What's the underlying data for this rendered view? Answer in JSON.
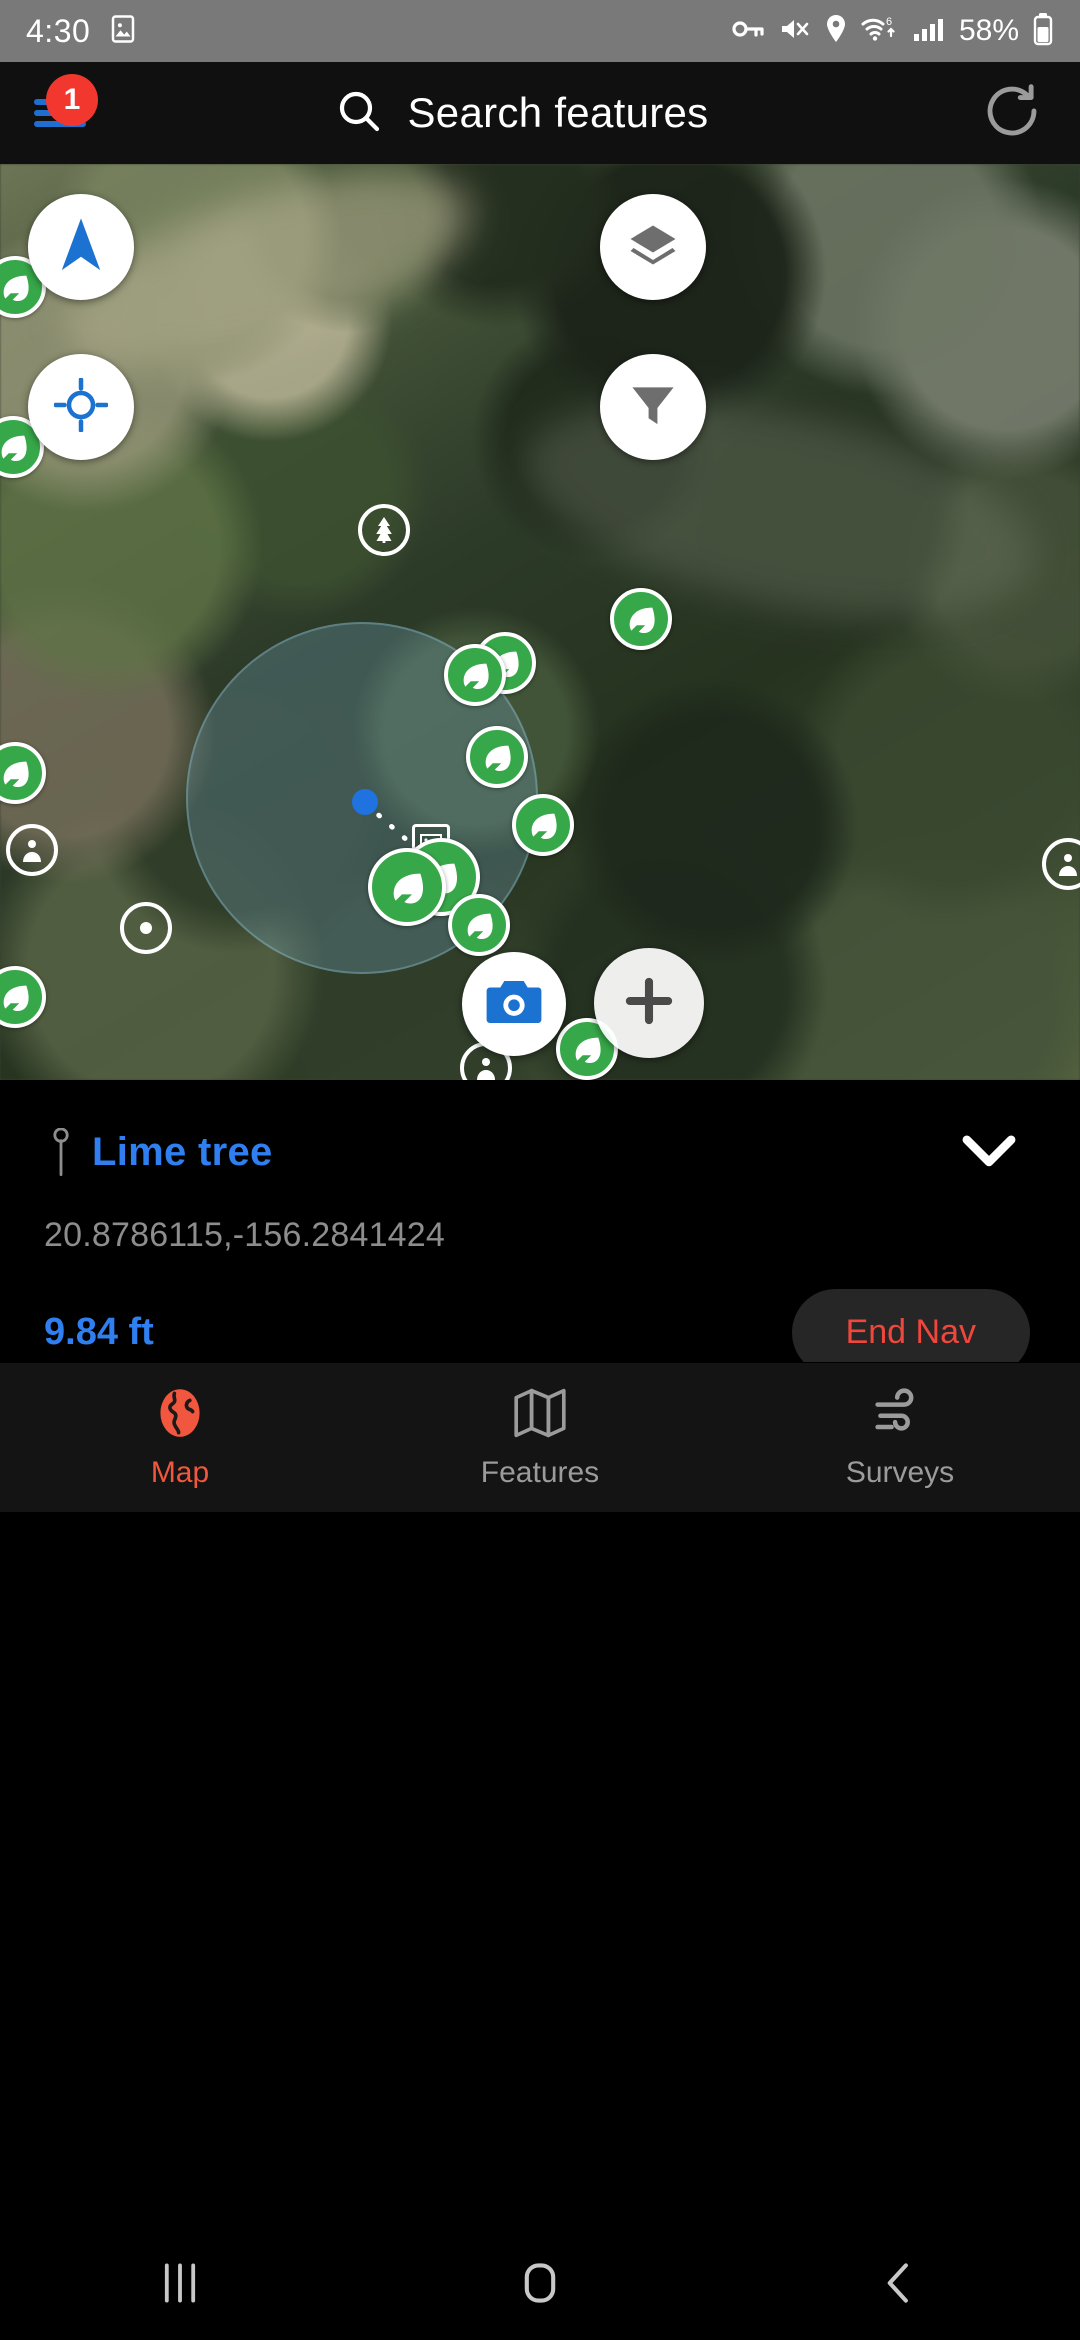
{
  "status_bar": {
    "time": "4:30",
    "battery_percent": "58%",
    "icons": [
      "image-icon",
      "key-icon",
      "mute-icon",
      "location-icon",
      "wifi-6-icon",
      "cell-signal-icon",
      "battery-icon"
    ]
  },
  "app_bar": {
    "menu_icon": "hamburger-menu-icon",
    "menu_badge_count": "1",
    "search_icon": "search-icon",
    "search_placeholder": "Search features",
    "refresh_icon": "refresh-icon"
  },
  "map": {
    "controls": {
      "navigate_icon": "navigation-arrow-icon",
      "locate_icon": "crosshair-target-icon",
      "layers_icon": "layers-icon",
      "filter_icon": "filter-funnel-icon",
      "camera_icon": "camera-icon",
      "add_icon": "plus-icon"
    },
    "user_location_icon": "user-location-dot",
    "tree_marker_icon": "tree-icon",
    "photo_marker_icon": "photo-placeholder-icon",
    "leaf_marker_icon": "leaf-marker-icon",
    "leaf_marker_count": "13",
    "accuracy_circle_color": "#73a5be",
    "marker_green": "#37a849",
    "accent_blue": "#2f7ff0"
  },
  "info_panel": {
    "pin_icon": "map-pin-icon",
    "feature_name": "Lime tree",
    "coordinates": "20.8786115,-156.2841424",
    "distance": "9.84 ft",
    "end_nav_label": "End Nav",
    "collapse_icon": "chevron-down-icon",
    "title_color": "#2f7ff0",
    "end_nav_color": "#f0463c"
  },
  "bottom_nav": {
    "active_color": "#f0573e",
    "items": [
      {
        "label": "Map",
        "icon": "globe-icon",
        "active": true
      },
      {
        "label": "Features",
        "icon": "map-fold-icon",
        "active": false
      },
      {
        "label": "Surveys",
        "icon": "wind-icon",
        "active": false
      }
    ]
  },
  "system_nav": {
    "recents_icon": "recents-icon",
    "home_icon": "home-icon",
    "back_icon": "back-icon"
  }
}
